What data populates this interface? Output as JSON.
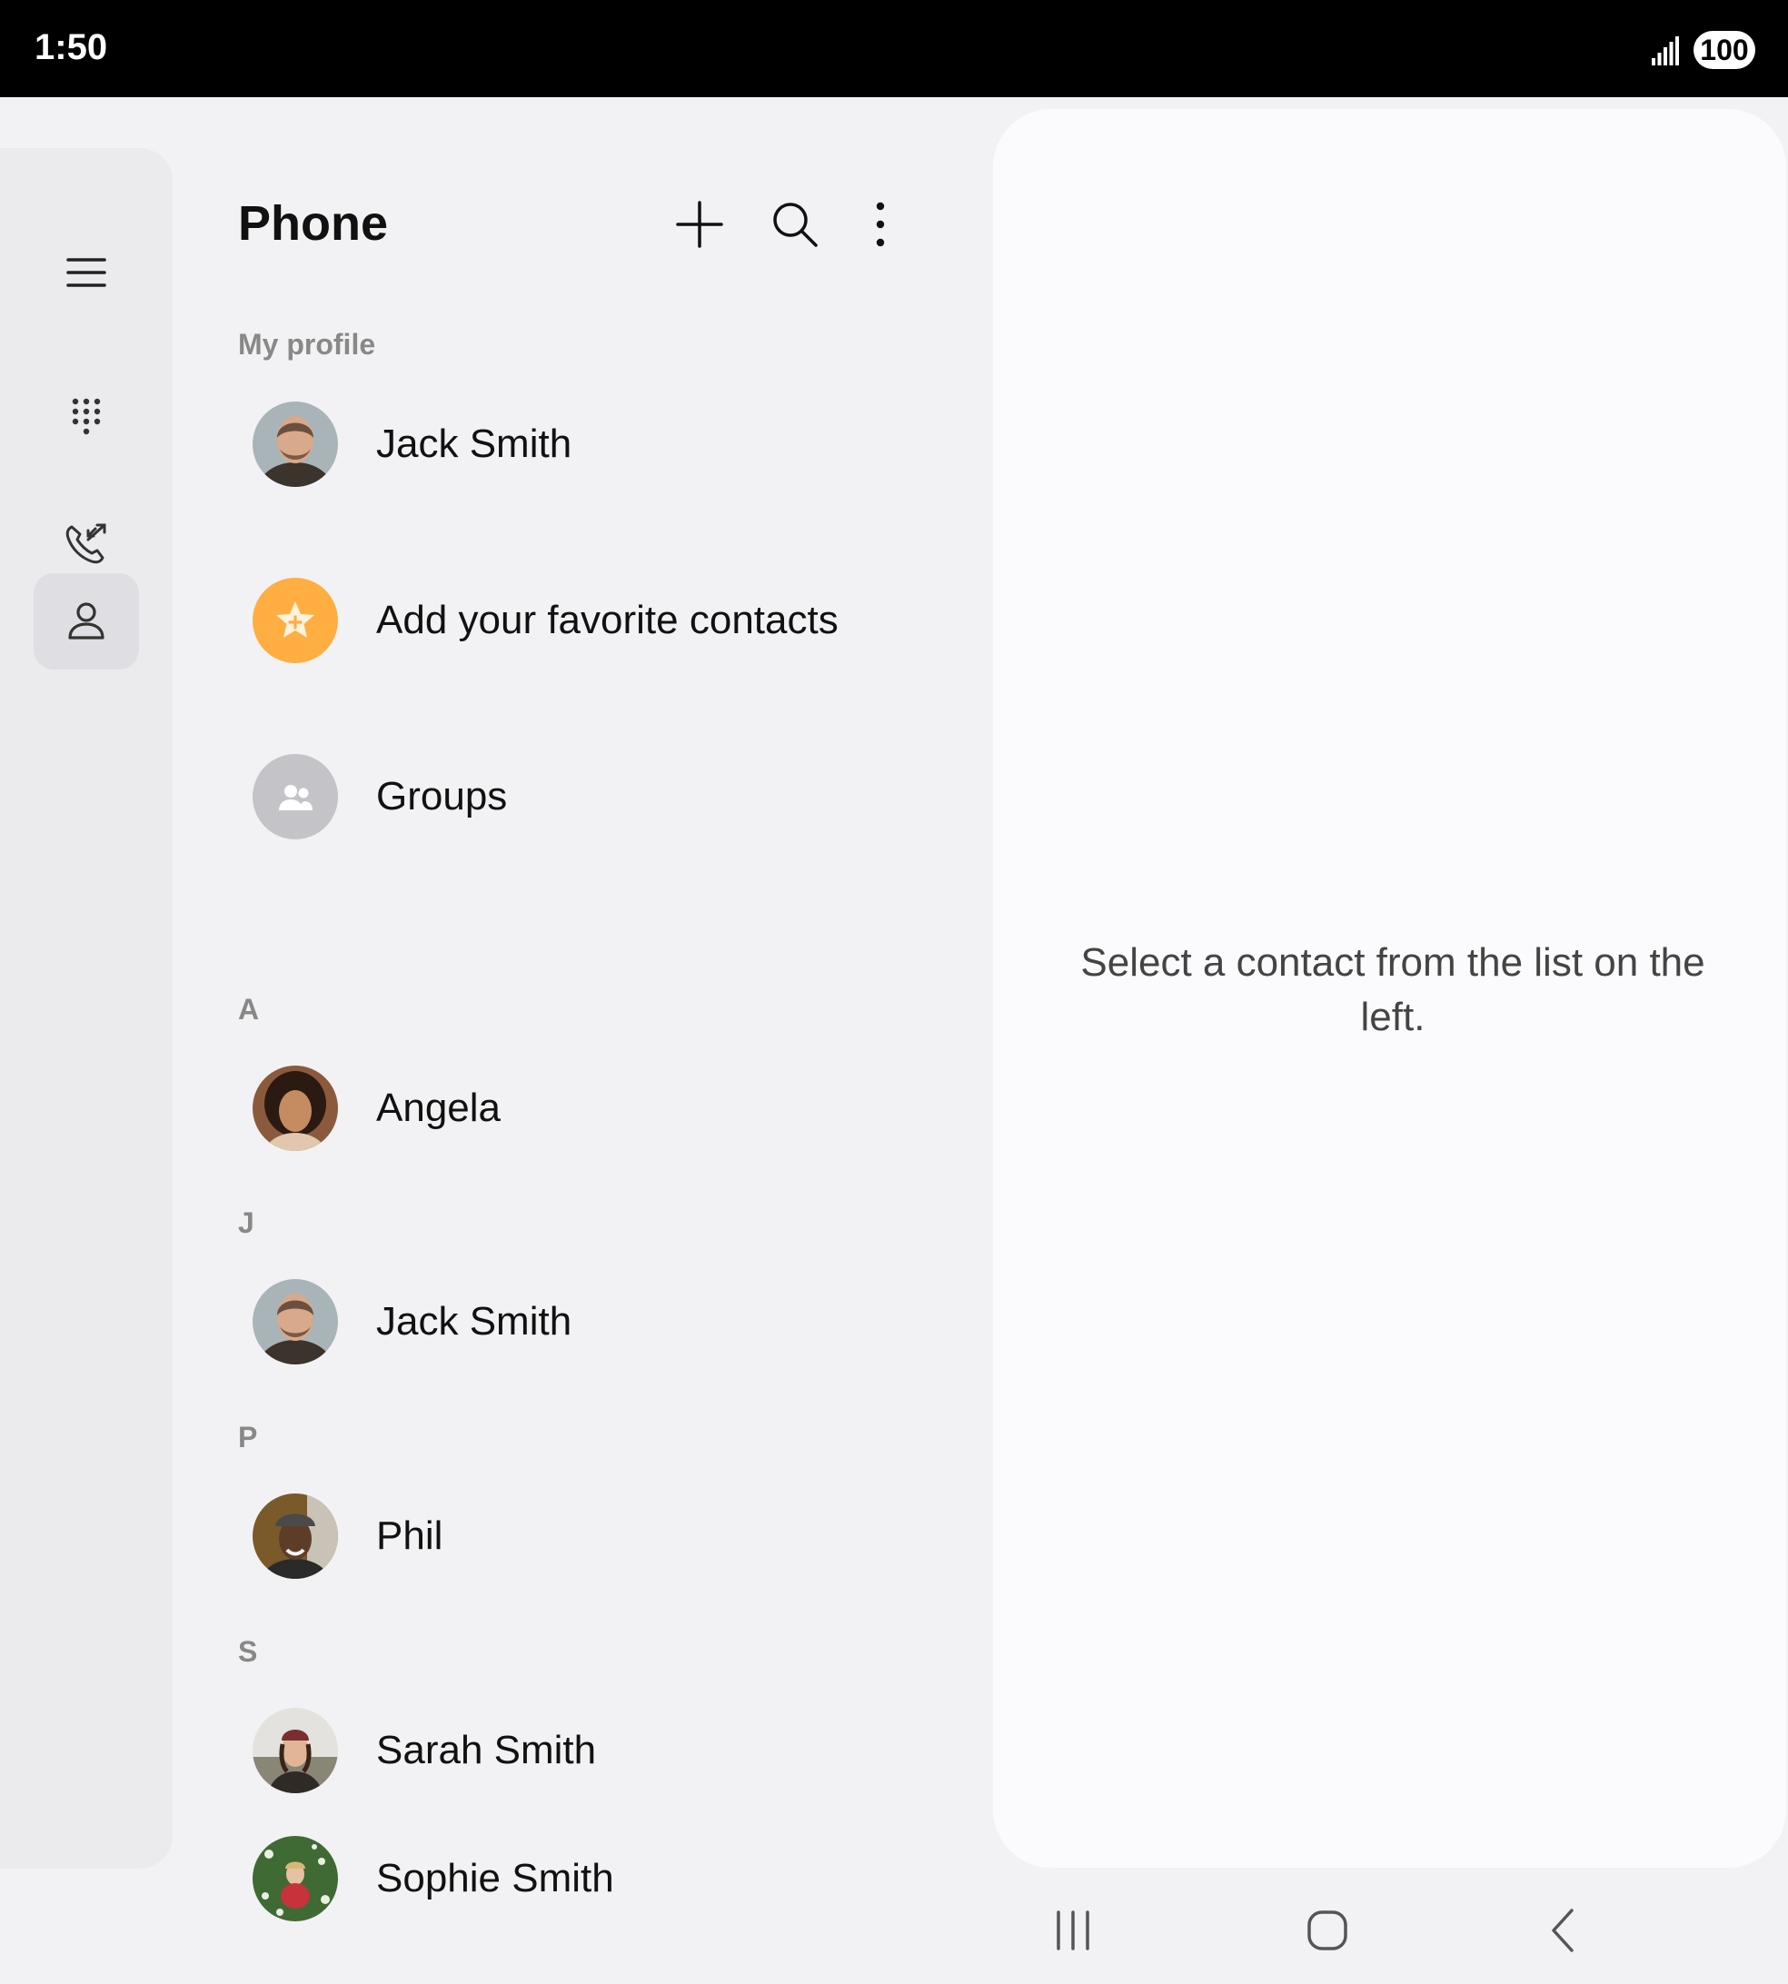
{
  "status_bar": {
    "time": "1:50",
    "battery": "100"
  },
  "nav_rail": {
    "items": [
      {
        "icon": "menu-icon"
      },
      {
        "icon": "keypad-icon"
      },
      {
        "icon": "recents-icon"
      },
      {
        "icon": "contacts-icon",
        "active": true
      }
    ]
  },
  "header": {
    "title": "Phone"
  },
  "profile": {
    "section_label": "My profile",
    "name": "Jack Smith"
  },
  "favorites": {
    "label": "Add your favorite contacts",
    "color": "#ffae42"
  },
  "groups": {
    "label": "Groups",
    "color": "#c4c4c8"
  },
  "sections": [
    {
      "letter": "A",
      "contacts": [
        "Angela"
      ]
    },
    {
      "letter": "J",
      "contacts": [
        "Jack Smith"
      ]
    },
    {
      "letter": "P",
      "contacts": [
        "Phil"
      ]
    },
    {
      "letter": "S",
      "contacts": [
        "Sarah Smith",
        "Sophie Smith"
      ]
    }
  ],
  "detail": {
    "empty_message": "Select a contact from the list on the left."
  },
  "system_nav": {
    "buttons": [
      "recents-icon",
      "home-icon",
      "back-icon"
    ]
  }
}
